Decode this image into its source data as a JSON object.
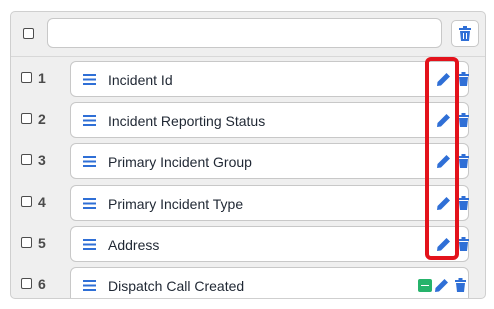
{
  "header": {
    "select_all_checked": false,
    "search_value": "",
    "delete_icon": "trash-icon"
  },
  "rows": [
    {
      "number": "1",
      "label": "Incident Id"
    },
    {
      "number": "2",
      "label": "Incident Reporting Status"
    },
    {
      "number": "3",
      "label": "Primary Incident Group"
    },
    {
      "number": "4",
      "label": "Primary Incident Type"
    },
    {
      "number": "5",
      "label": "Address"
    },
    {
      "number": "6",
      "label": "Dispatch Call Created"
    }
  ],
  "colors": {
    "accent_blue": "#2f6fd6",
    "highlight_red": "#e3121b",
    "tag_green": "#26b36b"
  }
}
